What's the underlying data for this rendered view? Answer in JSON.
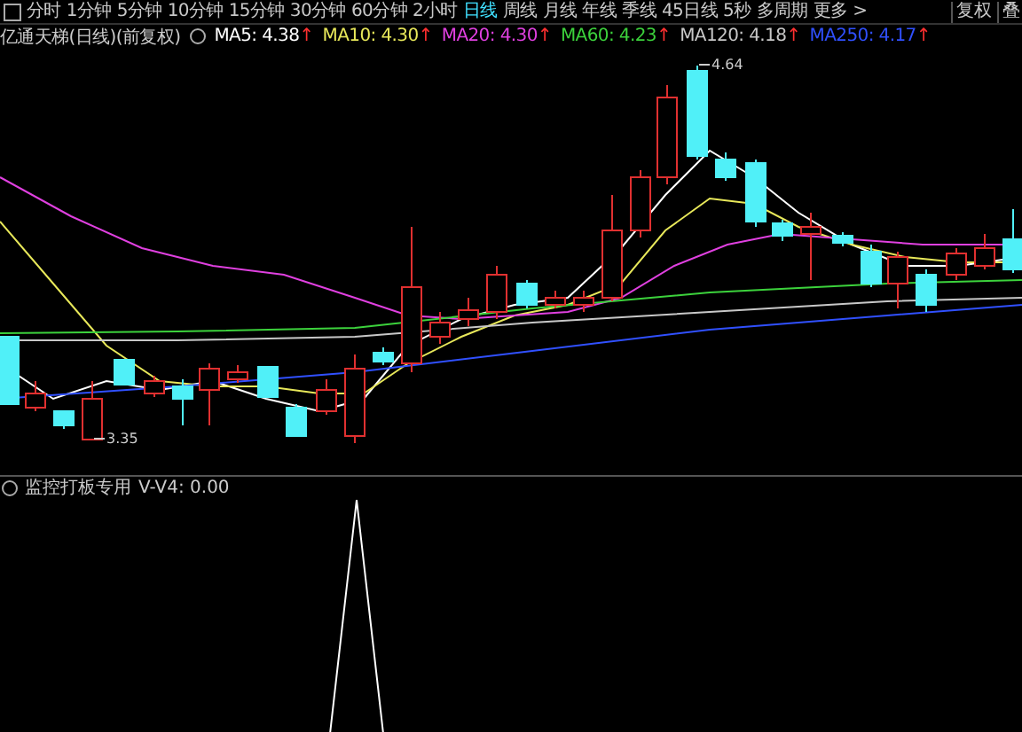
{
  "toolbar": {
    "items": [
      {
        "label": "分时",
        "selected": false
      },
      {
        "label": "1分钟",
        "selected": false
      },
      {
        "label": "5分钟",
        "selected": false
      },
      {
        "label": "10分钟",
        "selected": false
      },
      {
        "label": "15分钟",
        "selected": false
      },
      {
        "label": "30分钟",
        "selected": false
      },
      {
        "label": "60分钟",
        "selected": false
      },
      {
        "label": "2小时",
        "selected": false
      },
      {
        "label": "日线",
        "selected": true
      },
      {
        "label": "周线",
        "selected": false
      },
      {
        "label": "月线",
        "selected": false
      },
      {
        "label": "年线",
        "selected": false
      },
      {
        "label": "季线",
        "selected": false
      },
      {
        "label": "45日线",
        "selected": false
      },
      {
        "label": "5秒",
        "selected": false
      },
      {
        "label": "多周期",
        "selected": false
      },
      {
        "label": "更多 >",
        "selected": false
      }
    ],
    "right_buttons": [
      "复权",
      "叠"
    ]
  },
  "main_chart": {
    "title": "亿通天梯(日线)(前复权)",
    "moving_averages": [
      {
        "label": "MA5: 4.38",
        "trend": "↑",
        "color": "#ffffff"
      },
      {
        "label": "MA10: 4.30",
        "trend": "↑",
        "color": "#e8e85a"
      },
      {
        "label": "MA20: 4.30",
        "trend": "↑",
        "color": "#e040e0"
      },
      {
        "label": "MA60: 4.23",
        "trend": "↑",
        "color": "#3cd23c"
      },
      {
        "label": "MA120: 4.18",
        "trend": "↑",
        "color": "#c8c8c8"
      },
      {
        "label": "MA250: 4.17",
        "trend": "↑",
        "color": "#3050ff"
      }
    ],
    "price_labels": [
      {
        "kind": "high",
        "text": "4.64"
      },
      {
        "kind": "low",
        "text": "3.35"
      }
    ]
  },
  "sub_chart": {
    "title": "监控打板专用",
    "reading": "V-V4: 0.00"
  }
}
